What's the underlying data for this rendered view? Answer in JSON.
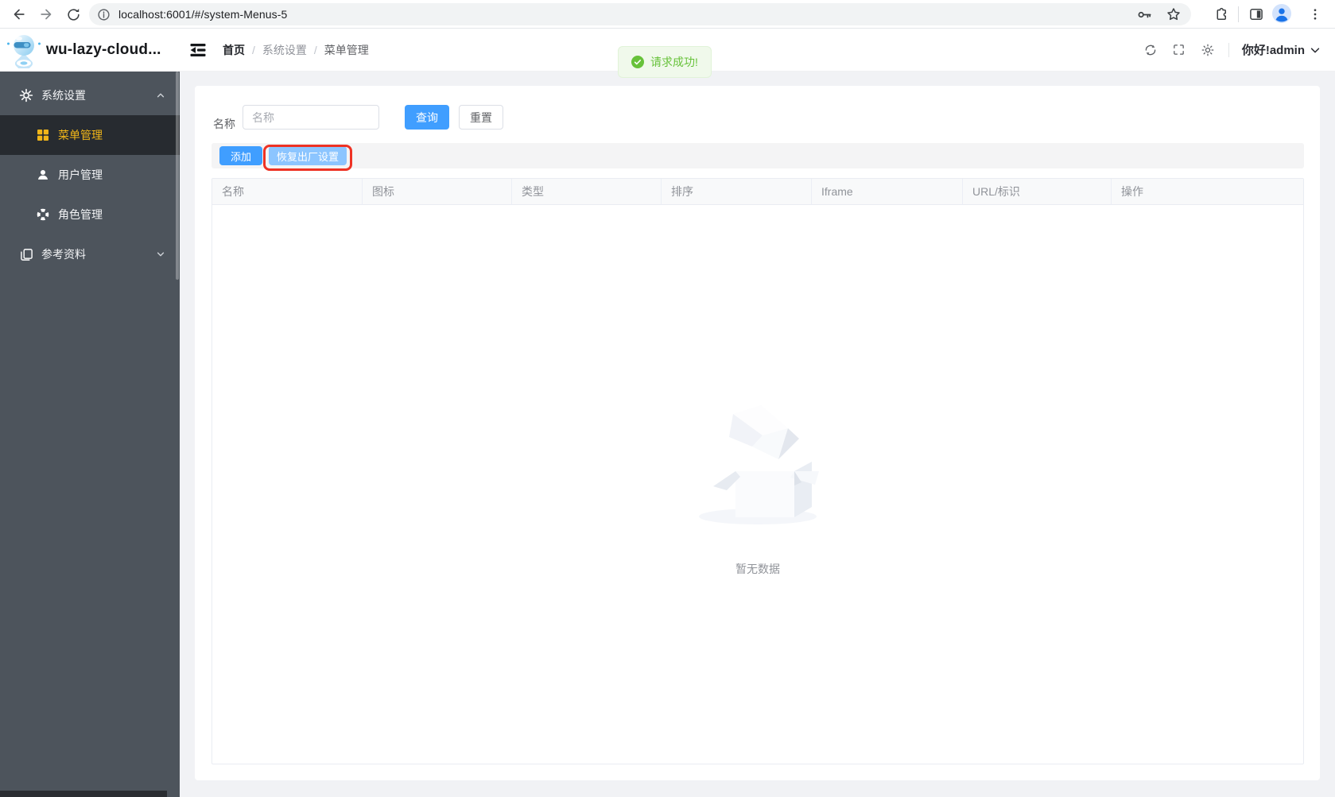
{
  "browser": {
    "url": "localhost:6001/#/system-Menus-5"
  },
  "sidebar": {
    "title": "wu-lazy-cloud...",
    "menu": [
      {
        "label": "系统设置",
        "state": "expanded"
      },
      {
        "label": "菜单管理",
        "state": "active"
      },
      {
        "label": "用户管理",
        "state": "normal"
      },
      {
        "label": "角色管理",
        "state": "normal"
      },
      {
        "label": "参考资料",
        "state": "collapsed"
      }
    ]
  },
  "header": {
    "breadcrumb": [
      "首页",
      "系统设置",
      "菜单管理"
    ],
    "separator": "/",
    "user": "你好!admin"
  },
  "toast": {
    "message": "请求成功!"
  },
  "search": {
    "label": "名称",
    "placeholder": "名称",
    "query": "查询",
    "reset": "重置"
  },
  "toolbar": {
    "add": "添加",
    "factory_reset": "恢复出厂设置"
  },
  "table": {
    "columns": [
      "名称",
      "图标",
      "类型",
      "排序",
      "Iframe",
      "URL/标识",
      "操作"
    ],
    "rows": []
  },
  "empty": {
    "text": "暂无数据"
  },
  "colors": {
    "primary": "#409eff",
    "primary_light": "#8cc5ff",
    "success": "#67c23a",
    "toast_bg": "#f0f9eb",
    "sidebar_bg": "#4d545c",
    "sidebar_active_bg": "#272b30",
    "sidebar_active_text": "#f0b519",
    "highlight_red": "#ee3224",
    "page_bg": "#f1f2f5"
  }
}
